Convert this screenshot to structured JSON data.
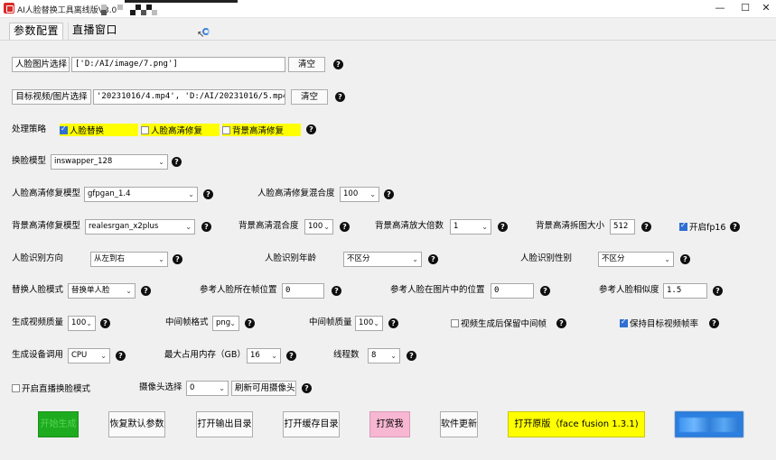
{
  "window": {
    "title": "AI人脸替换工具离线版V3.0",
    "minimize_glyph": "—",
    "maximize_glyph": "☐",
    "close_glyph": "✕"
  },
  "tabs": [
    {
      "label": "参数配置",
      "active": true
    },
    {
      "label": "直播窗口",
      "active": false
    }
  ],
  "help_glyph": "?",
  "combo_arrow": "⌄",
  "face_image": {
    "button": "人脸图片选择",
    "value": "['D:/AI/image/7.png']",
    "clear": "清空"
  },
  "target_media": {
    "button": "目标视频/图片选择",
    "value": "'20231016/4.mp4', 'D:/AI/20231016/5.mp4']",
    "clear": "清空"
  },
  "strategy": {
    "label": "处理策略",
    "options": [
      {
        "label": "人脸替换",
        "checked": true
      },
      {
        "label": "人脸高清修复",
        "checked": false
      },
      {
        "label": "背景高清修复",
        "checked": false
      }
    ],
    "highlight_color": "#ffff00"
  },
  "swap_model": {
    "label": "换脸模型",
    "value": "inswapper_128"
  },
  "face_enhance": {
    "model_label": "人脸高清修复模型",
    "model_value": "gfpgan_1.4",
    "blend_label": "人脸高清修复混合度",
    "blend_value": "100"
  },
  "bg_enhance": {
    "model_label": "背景高清修复模型",
    "model_value": "realesrgan_x2plus",
    "blend_label": "背景高清混合度",
    "blend_value": "100",
    "scale_label": "背景高清放大倍数",
    "scale_value": "1",
    "tile_label": "背景高清拆图大小",
    "tile_value": "512",
    "fp16_label": "开启fp16",
    "fp16_checked": true
  },
  "recognition": {
    "direction_label": "人脸识别方向",
    "direction_value": "从左到右",
    "age_label": "人脸识别年龄",
    "age_value": "不区分",
    "gender_label": "人脸识别性别",
    "gender_value": "不区分"
  },
  "replace": {
    "mode_label": "替换人脸模式",
    "mode_value": "替换单人脸",
    "frame_pos_label": "参考人脸所在帧位置",
    "frame_pos_value": "0",
    "img_pos_label": "参考人脸在图片中的位置",
    "img_pos_value": "0",
    "similarity_label": "参考人脸相似度",
    "similarity_value": "1.5"
  },
  "output": {
    "quality_label": "生成视频质量",
    "quality_value": "100",
    "frame_format_label": "中间帧格式",
    "frame_format_value": "png",
    "frame_quality_label": "中间帧质量",
    "frame_quality_value": "100",
    "keep_frames_label": "视频生成后保留中间帧",
    "keep_frames_checked": false,
    "keep_fps_label": "保持目标视频帧率",
    "keep_fps_checked": true
  },
  "device": {
    "device_label": "生成设备调用",
    "device_value": "CPU",
    "memory_label": "最大占用内存（GB）",
    "memory_value": "16",
    "threads_label": "线程数",
    "threads_value": "8"
  },
  "live": {
    "mode_label": "开启直播换脸模式",
    "mode_checked": false,
    "camera_label": "摄像头选择",
    "camera_value": "0",
    "refresh_button": "刷新可用摄像头"
  },
  "actions": {
    "start": "开始生成",
    "reset": "恢复默认参数",
    "open_output": "打开输出目录",
    "open_cache": "打开缓存目录",
    "donate": "打赏我",
    "update": "软件更新",
    "open_original": "打开原版（face fusion 1.3.1)",
    "start_color": "#1fab1f",
    "donate_color": "#f7b6d2",
    "original_color": "#ffff00",
    "blurred_color": "#2b7fe0"
  }
}
